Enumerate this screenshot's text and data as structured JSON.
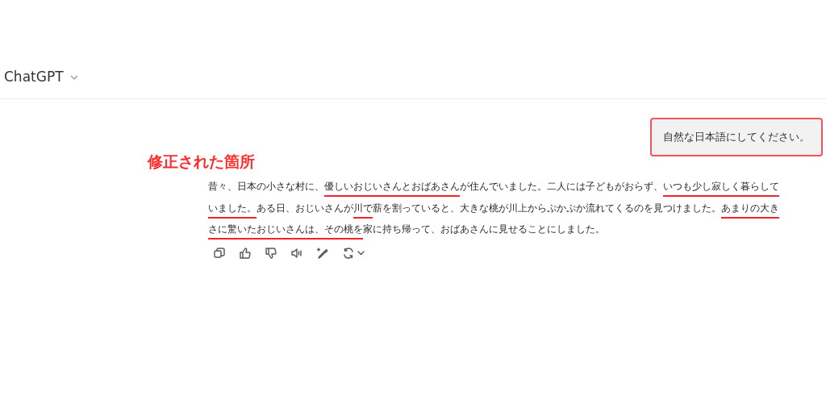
{
  "header": {
    "title": "ChatGPT"
  },
  "user_message": {
    "text": "自然な日本語にしてください。",
    "highlighted": true
  },
  "annotation_label": "修正された箇所",
  "response": {
    "lines": [
      [
        {
          "text": "昔々、日本の小さな村に、",
          "underlined": false
        },
        {
          "text": "優しいおじいさんとおばあさん",
          "underlined": true
        },
        {
          "text": "が住んでいました。二人には子どもがおらず、",
          "underlined": false
        },
        {
          "text": "いつも少し寂しく暮らして",
          "underlined": true
        }
      ],
      [
        {
          "text": "いました。",
          "underlined": true
        },
        {
          "text": "ある日、おじいさんが",
          "underlined": false
        },
        {
          "text": "川で",
          "underlined": true
        },
        {
          "text": "薪を割っていると、大きな桃が川上からぷかぷか流れてくるのを見つけました。",
          "underlined": false
        },
        {
          "text": "あまりの大き",
          "underlined": true
        }
      ],
      [
        {
          "text": "さに驚いたおじいさんは、その桃を",
          "underlined": true
        },
        {
          "text": "家に持ち帰って、おばあさんに見せることにしました。",
          "underlined": false
        }
      ]
    ]
  },
  "actions": [
    {
      "kind": "copy"
    },
    {
      "kind": "thumbs_up"
    },
    {
      "kind": "thumbs_down"
    },
    {
      "kind": "speaker"
    },
    {
      "kind": "edit"
    },
    {
      "kind": "regenerate"
    }
  ]
}
